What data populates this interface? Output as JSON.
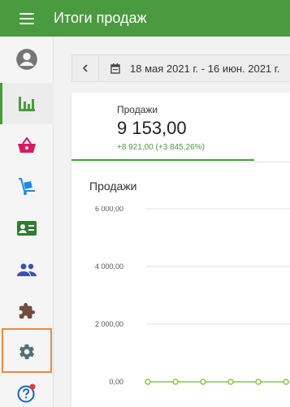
{
  "app": {
    "title": "Итоги продаж"
  },
  "sidebar": {
    "items": [
      {
        "name": "account",
        "icon": "account-circle-icon",
        "color": "#757575"
      },
      {
        "name": "reports",
        "icon": "bar-chart-icon",
        "color": "#4a9a3f",
        "active": true
      },
      {
        "name": "sales",
        "icon": "basket-icon",
        "color": "#d81b60"
      },
      {
        "name": "delivery",
        "icon": "cart-dolly-icon",
        "color": "#1e88e5"
      },
      {
        "name": "customers",
        "icon": "contact-card-icon",
        "color": "#2e7d32"
      },
      {
        "name": "staff",
        "icon": "people-icon",
        "color": "#3f51b5"
      },
      {
        "name": "integrations",
        "icon": "puzzle-icon",
        "color": "#6d4c41"
      },
      {
        "name": "settings",
        "icon": "gear-icon",
        "color": "#546e7a",
        "focused": true
      },
      {
        "name": "help",
        "icon": "help-icon",
        "color": "#1565c0"
      }
    ]
  },
  "filters": {
    "date_range": "18 мая 2021 г. - 16 июн. 2021 г."
  },
  "kpi": {
    "label": "Продажи",
    "value": "9 153,00",
    "delta": "+8 921,00 (+3 845,26%)"
  },
  "chart": {
    "title": "Продажи"
  },
  "chart_data": {
    "type": "line",
    "title": "Продажи",
    "y_ticks": [
      "6 000,00",
      "4 000,00",
      "2 000,00",
      "0,00"
    ],
    "ylim": [
      0,
      6000
    ],
    "series": [
      {
        "values": [
          0,
          0,
          0,
          0,
          0,
          0
        ]
      }
    ],
    "grid": true,
    "color": "#8bc34a"
  }
}
